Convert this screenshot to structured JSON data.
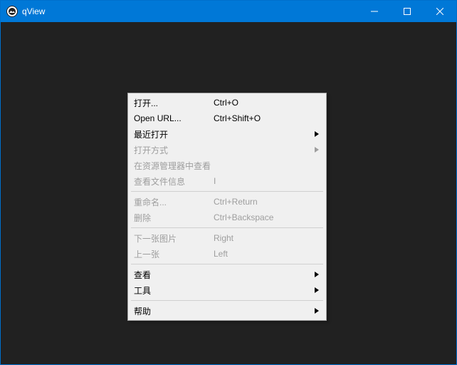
{
  "window": {
    "title": "qView",
    "bgcolor": "#212121",
    "titlebar_color": "#0078d7"
  },
  "context_menu": {
    "groups": [
      [
        {
          "label": "打开...",
          "shortcut": "Ctrl+O",
          "enabled": true,
          "submenu": false
        },
        {
          "label": "Open URL...",
          "shortcut": "Ctrl+Shift+O",
          "enabled": true,
          "submenu": false
        },
        {
          "label": "最近打开",
          "shortcut": "",
          "enabled": true,
          "submenu": true
        },
        {
          "label": "打开方式",
          "shortcut": "",
          "enabled": false,
          "submenu": true
        },
        {
          "label": "在资源管理器中查看",
          "shortcut": "",
          "enabled": false,
          "submenu": false
        },
        {
          "label": "查看文件信息",
          "shortcut": "I",
          "enabled": false,
          "submenu": false
        }
      ],
      [
        {
          "label": "重命名...",
          "shortcut": "Ctrl+Return",
          "enabled": false,
          "submenu": false
        },
        {
          "label": "删除",
          "shortcut": "Ctrl+Backspace",
          "enabled": false,
          "submenu": false
        }
      ],
      [
        {
          "label": "下一张图片",
          "shortcut": "Right",
          "enabled": false,
          "submenu": false
        },
        {
          "label": "上一张",
          "shortcut": "Left",
          "enabled": false,
          "submenu": false
        }
      ],
      [
        {
          "label": "查看",
          "shortcut": "",
          "enabled": true,
          "submenu": true
        },
        {
          "label": "工具",
          "shortcut": "",
          "enabled": true,
          "submenu": true
        }
      ],
      [
        {
          "label": "帮助",
          "shortcut": "",
          "enabled": true,
          "submenu": true
        }
      ]
    ]
  }
}
